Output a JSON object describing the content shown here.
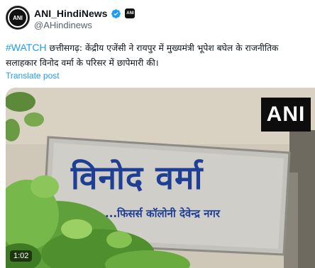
{
  "account": {
    "display_name": "ANI_HindiNews",
    "handle": "@AHindinews",
    "avatar_text": "ANI",
    "affiliate_badge_text": "ANI"
  },
  "tweet": {
    "hashtag": "#WATCH",
    "text": " छत्तीसगढ़: केंद्रीय एजेंसी ने रायपुर में मुख्यमंत्री भूपेश बघेल के राजनीतिक सलाहकार विनोद वर्मा के परिसर में छापेमारी की।",
    "translate_label": "Translate post"
  },
  "media": {
    "watermark": "ANI",
    "sign_title": "विनोद वर्मा",
    "sign_subtitle": "...फिसर्स कॉलोनी देवेन्द्र नगर",
    "duration": "1:02"
  },
  "colors": {
    "link": "#1d9bf0",
    "verified": "#1d9bf0",
    "sign_ink": "#1f3f94",
    "text": "#0f1419",
    "muted": "#536471"
  },
  "icons": {
    "verified": "verified-badge-icon",
    "affiliate": "ani-affiliate-badge-icon"
  }
}
